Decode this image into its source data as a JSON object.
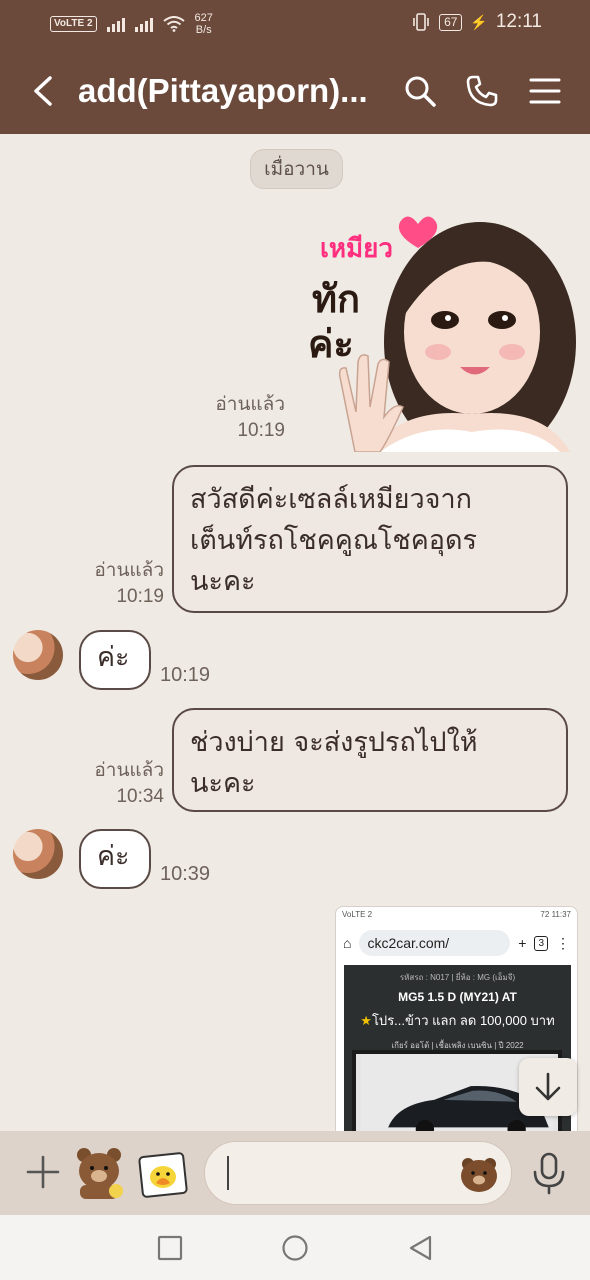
{
  "status_bar": {
    "volte": "VoLTE 2",
    "net_speed_value": "627",
    "net_speed_unit": "B/s",
    "battery": "67",
    "time": "12:11"
  },
  "header": {
    "title": "add(Pittayaporn)...",
    "icons": [
      "back-icon",
      "search-icon",
      "phone-icon",
      "menu-icon"
    ]
  },
  "chat": {
    "date_chip": "เมื่อวาน",
    "sticker": {
      "read_label": "อ่านแล้ว",
      "time": "10:19",
      "text_line1": "เหมียว",
      "text_line2": "ทัก",
      "text_line3": "ค่ะ"
    },
    "messages": [
      {
        "direction": "out",
        "read_label": "อ่านแล้ว",
        "time": "10:19",
        "lines": [
          "สวัสดีค่ะเซลล์เหมียวจาก",
          "เต็นท์รถโชคคูณโชคอุดร",
          "นะคะ"
        ]
      },
      {
        "direction": "in",
        "text": "ค่ะ",
        "time": "10:19"
      },
      {
        "direction": "out",
        "read_label": "อ่านแล้ว",
        "time": "10:34",
        "lines": [
          "ช่วงบ่าย จะส่งรูปรถไปให้",
          "นะคะ"
        ]
      },
      {
        "direction": "in",
        "text": "ค่ะ",
        "time": "10:39"
      }
    ],
    "shared_image": {
      "status_left": "VoLTE 2",
      "status_right_batt": "72",
      "status_time": "11:37",
      "url": "ckc2car.com/",
      "tab_count": "3",
      "meta_line": "รหัสรถ : N017 | ยี่ห้อ : MG (เอ็มจี)",
      "model": "MG5 1.5 D (MY21) AT",
      "promo": "โปร...ข้าว แลก ลด 100,000 บาท",
      "features": "เกียร์ ออโต้  |  เชื้อเพลิง เบนซิน  |  ปี 2022"
    }
  },
  "input_bar": {
    "placeholder": ""
  },
  "colors": {
    "header": "#6b4a3c",
    "chat_bg": "#efeae4",
    "bubble_border": "#5a4a45",
    "outgoing_bubble": "#efe7e1",
    "incoming_bubble": "#ffffff"
  }
}
